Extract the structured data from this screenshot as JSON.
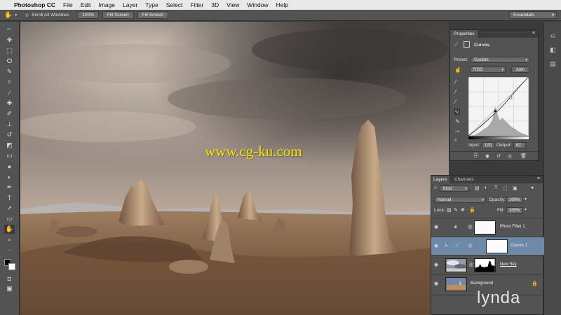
{
  "menubar": {
    "apple": "",
    "app_name": "Photoshop CC",
    "items": [
      "File",
      "Edit",
      "Image",
      "Layer",
      "Type",
      "Select",
      "Filter",
      "3D",
      "View",
      "Window",
      "Help"
    ]
  },
  "options_bar": {
    "scroll_all_label": "Scroll All Windows",
    "zoom_100": "100%",
    "fit_screen_1": "Fill Screen",
    "fit_screen_2": "Fill Screen",
    "workspace": "Essentials"
  },
  "canvas": {
    "watermark": "www.cg-ku.com"
  },
  "properties": {
    "tab_label": "Properties",
    "adjustment_name": "Curves",
    "preset_label": "Preset:",
    "preset_value": "Custom",
    "channel_value": "RGB",
    "auto_label": "Auto",
    "input_label": "Input:",
    "input_value": "100",
    "output_label": "Output:",
    "output_value": "62"
  },
  "layers": {
    "tab_layers": "Layers",
    "tab_channels": "Channels",
    "filter_kind": "Kind",
    "blend_mode": "Normal",
    "opacity_label": "Opacity:",
    "opacity_value": "100%",
    "lock_label": "Lock:",
    "fill_label": "Fill:",
    "fill_value": "100%",
    "rows": [
      {
        "name": "Photo Filter 1"
      },
      {
        "name": "Curves 1"
      },
      {
        "name": "New Sky"
      },
      {
        "name": "Background"
      }
    ]
  },
  "brand_watermark": "lynda",
  "colors": {
    "selection": "#6d89a8",
    "panel": "#535353",
    "watermark_yellow": "#f2e600"
  }
}
